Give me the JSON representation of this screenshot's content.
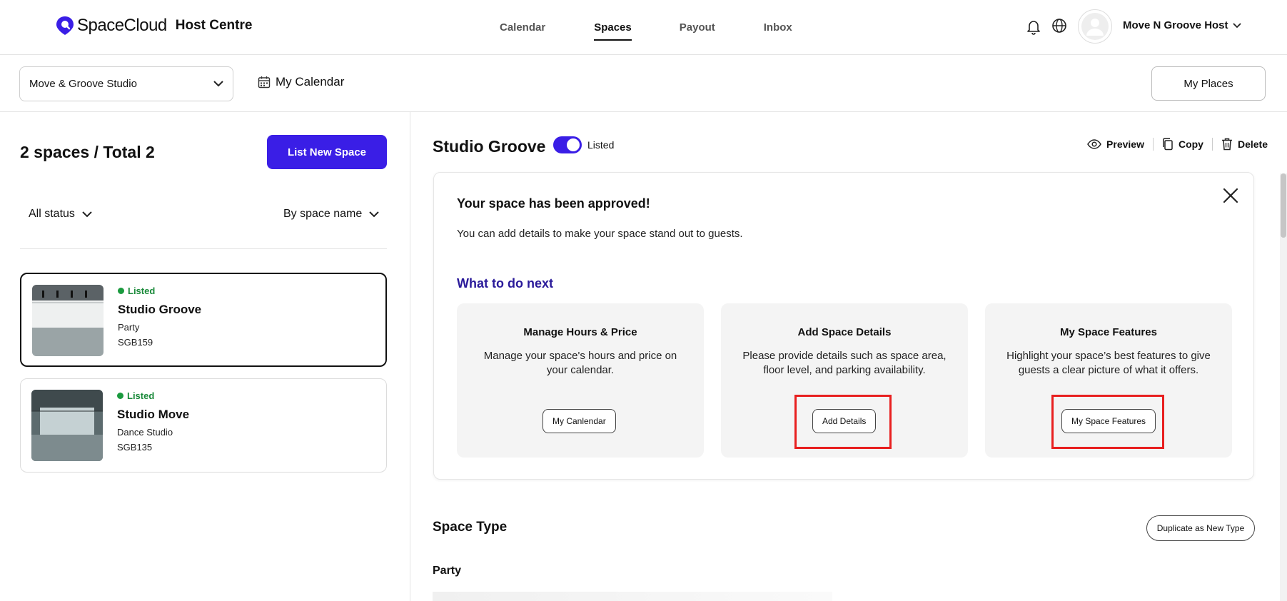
{
  "header": {
    "brand": "SpaceCloud",
    "brand_sub": "Host Centre",
    "nav": [
      "Calendar",
      "Spaces",
      "Payout",
      "Inbox"
    ],
    "active_nav": "Spaces",
    "user_name": "Move N Groove Host"
  },
  "subbar": {
    "place_selected": "Move & Groove Studio",
    "my_calendar": "My Calendar",
    "my_places": "My Places"
  },
  "sidebar": {
    "count_title": "2 spaces / Total 2",
    "list_new_button": "List New Space",
    "filter_status": "All status",
    "filter_sort": "By space name",
    "spaces": [
      {
        "status": "Listed",
        "name": "Studio Groove",
        "type": "Party",
        "code": "SGB159"
      },
      {
        "status": "Listed",
        "name": "Studio Move",
        "type": "Dance Studio",
        "code": "SGB135"
      }
    ]
  },
  "main": {
    "space_title": "Studio Groove",
    "toggle_label": "Listed",
    "actions": {
      "preview": "Preview",
      "copy": "Copy",
      "delete": "Delete"
    },
    "approval": {
      "title": "Your space has been approved!",
      "text": "You can add details to make your space stand out to guests.",
      "next_title": "What to do next",
      "tasks": [
        {
          "title": "Manage Hours & Price",
          "desc": "Manage your space's hours and price on your calendar.",
          "button": "My Canlendar"
        },
        {
          "title": "Add Space Details",
          "desc": "Please provide details such as space area, floor level, and parking availability.",
          "button": "Add Details"
        },
        {
          "title": "My Space Features",
          "desc": "Highlight your space’s best features to give guests a clear picture of what it offers.",
          "button": "My Space Features"
        }
      ]
    },
    "section_title": "Space Type",
    "duplicate_button": "Duplicate as New Type",
    "type_label": "Party"
  },
  "colors": {
    "accent": "#3a1ee6",
    "next_title": "#2a1a9a",
    "listed_green": "#1a8a3a",
    "highlight_red": "#e81f1f"
  }
}
